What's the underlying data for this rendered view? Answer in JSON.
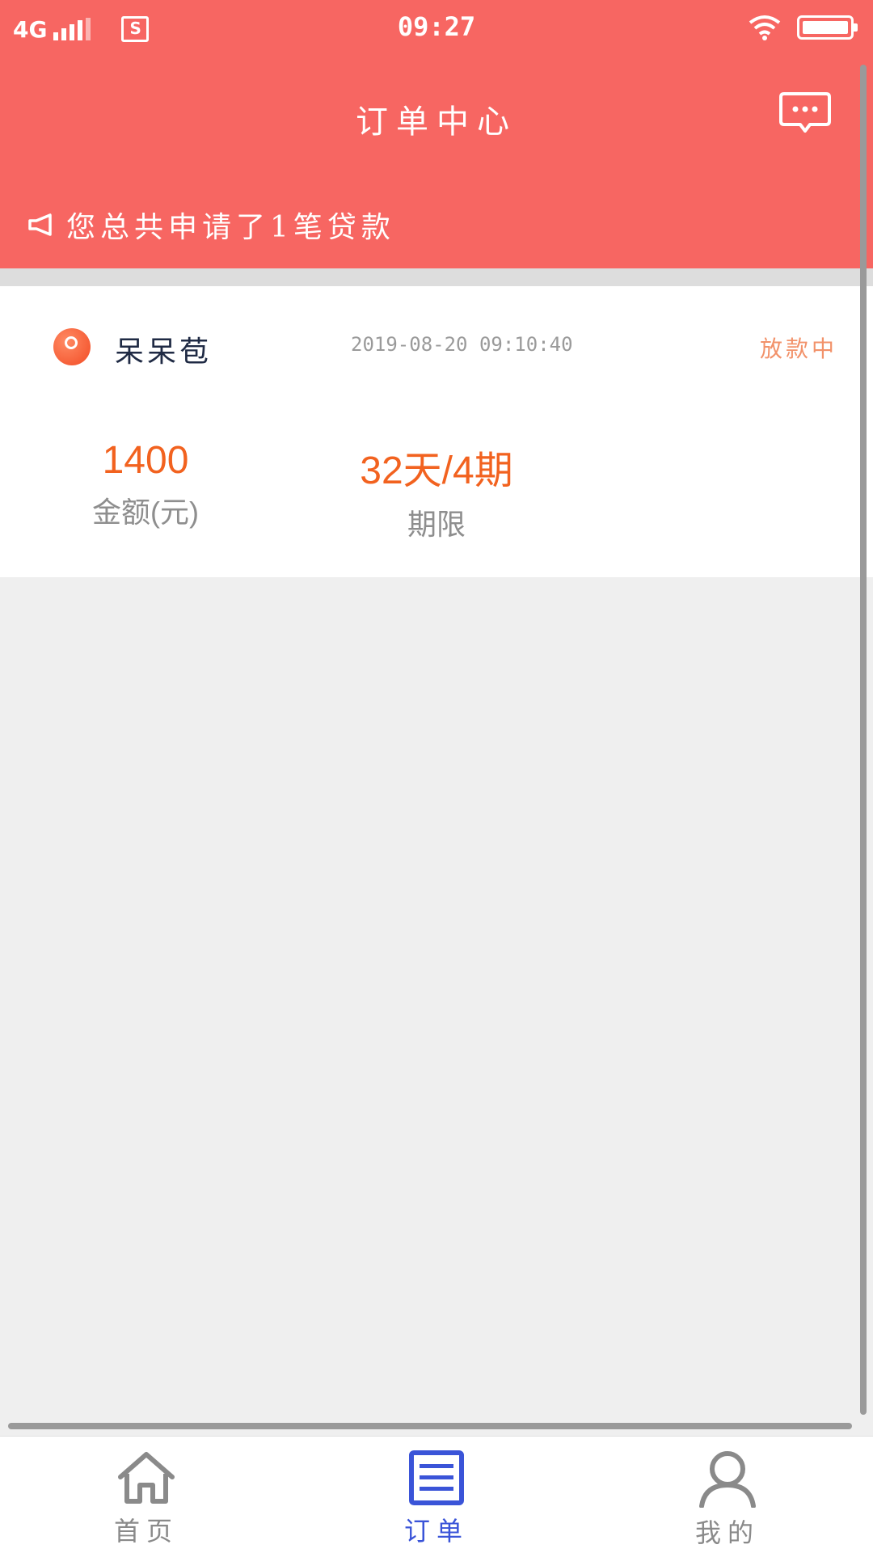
{
  "status_bar": {
    "network": "4G",
    "time": "09:27"
  },
  "header": {
    "title": "订单中心",
    "message_icon": "chat-dots-icon",
    "announcement_icon": "megaphone-icon",
    "announcement": "您总共申请了1笔贷款"
  },
  "order": {
    "lender_name": "呆呆苞",
    "lender_logo": "lender-logo",
    "time": "2019-08-20 09:10:40",
    "status": "放款中",
    "amount_value": "1400",
    "amount_label": "金额(元)",
    "term_value": "32天/4期",
    "term_label": "期限"
  },
  "tabbar": {
    "items": [
      {
        "label": "首页",
        "icon": "home-icon",
        "active": false
      },
      {
        "label": "订单",
        "icon": "order-list-icon",
        "active": true
      },
      {
        "label": "我的",
        "icon": "user-icon",
        "active": false
      }
    ]
  },
  "colors": {
    "brand": "#f76662",
    "accent_orange": "#f2621f",
    "tab_active": "#3a54d8",
    "tab_inactive": "#8a8a8a",
    "status_text": "#f2926a"
  }
}
